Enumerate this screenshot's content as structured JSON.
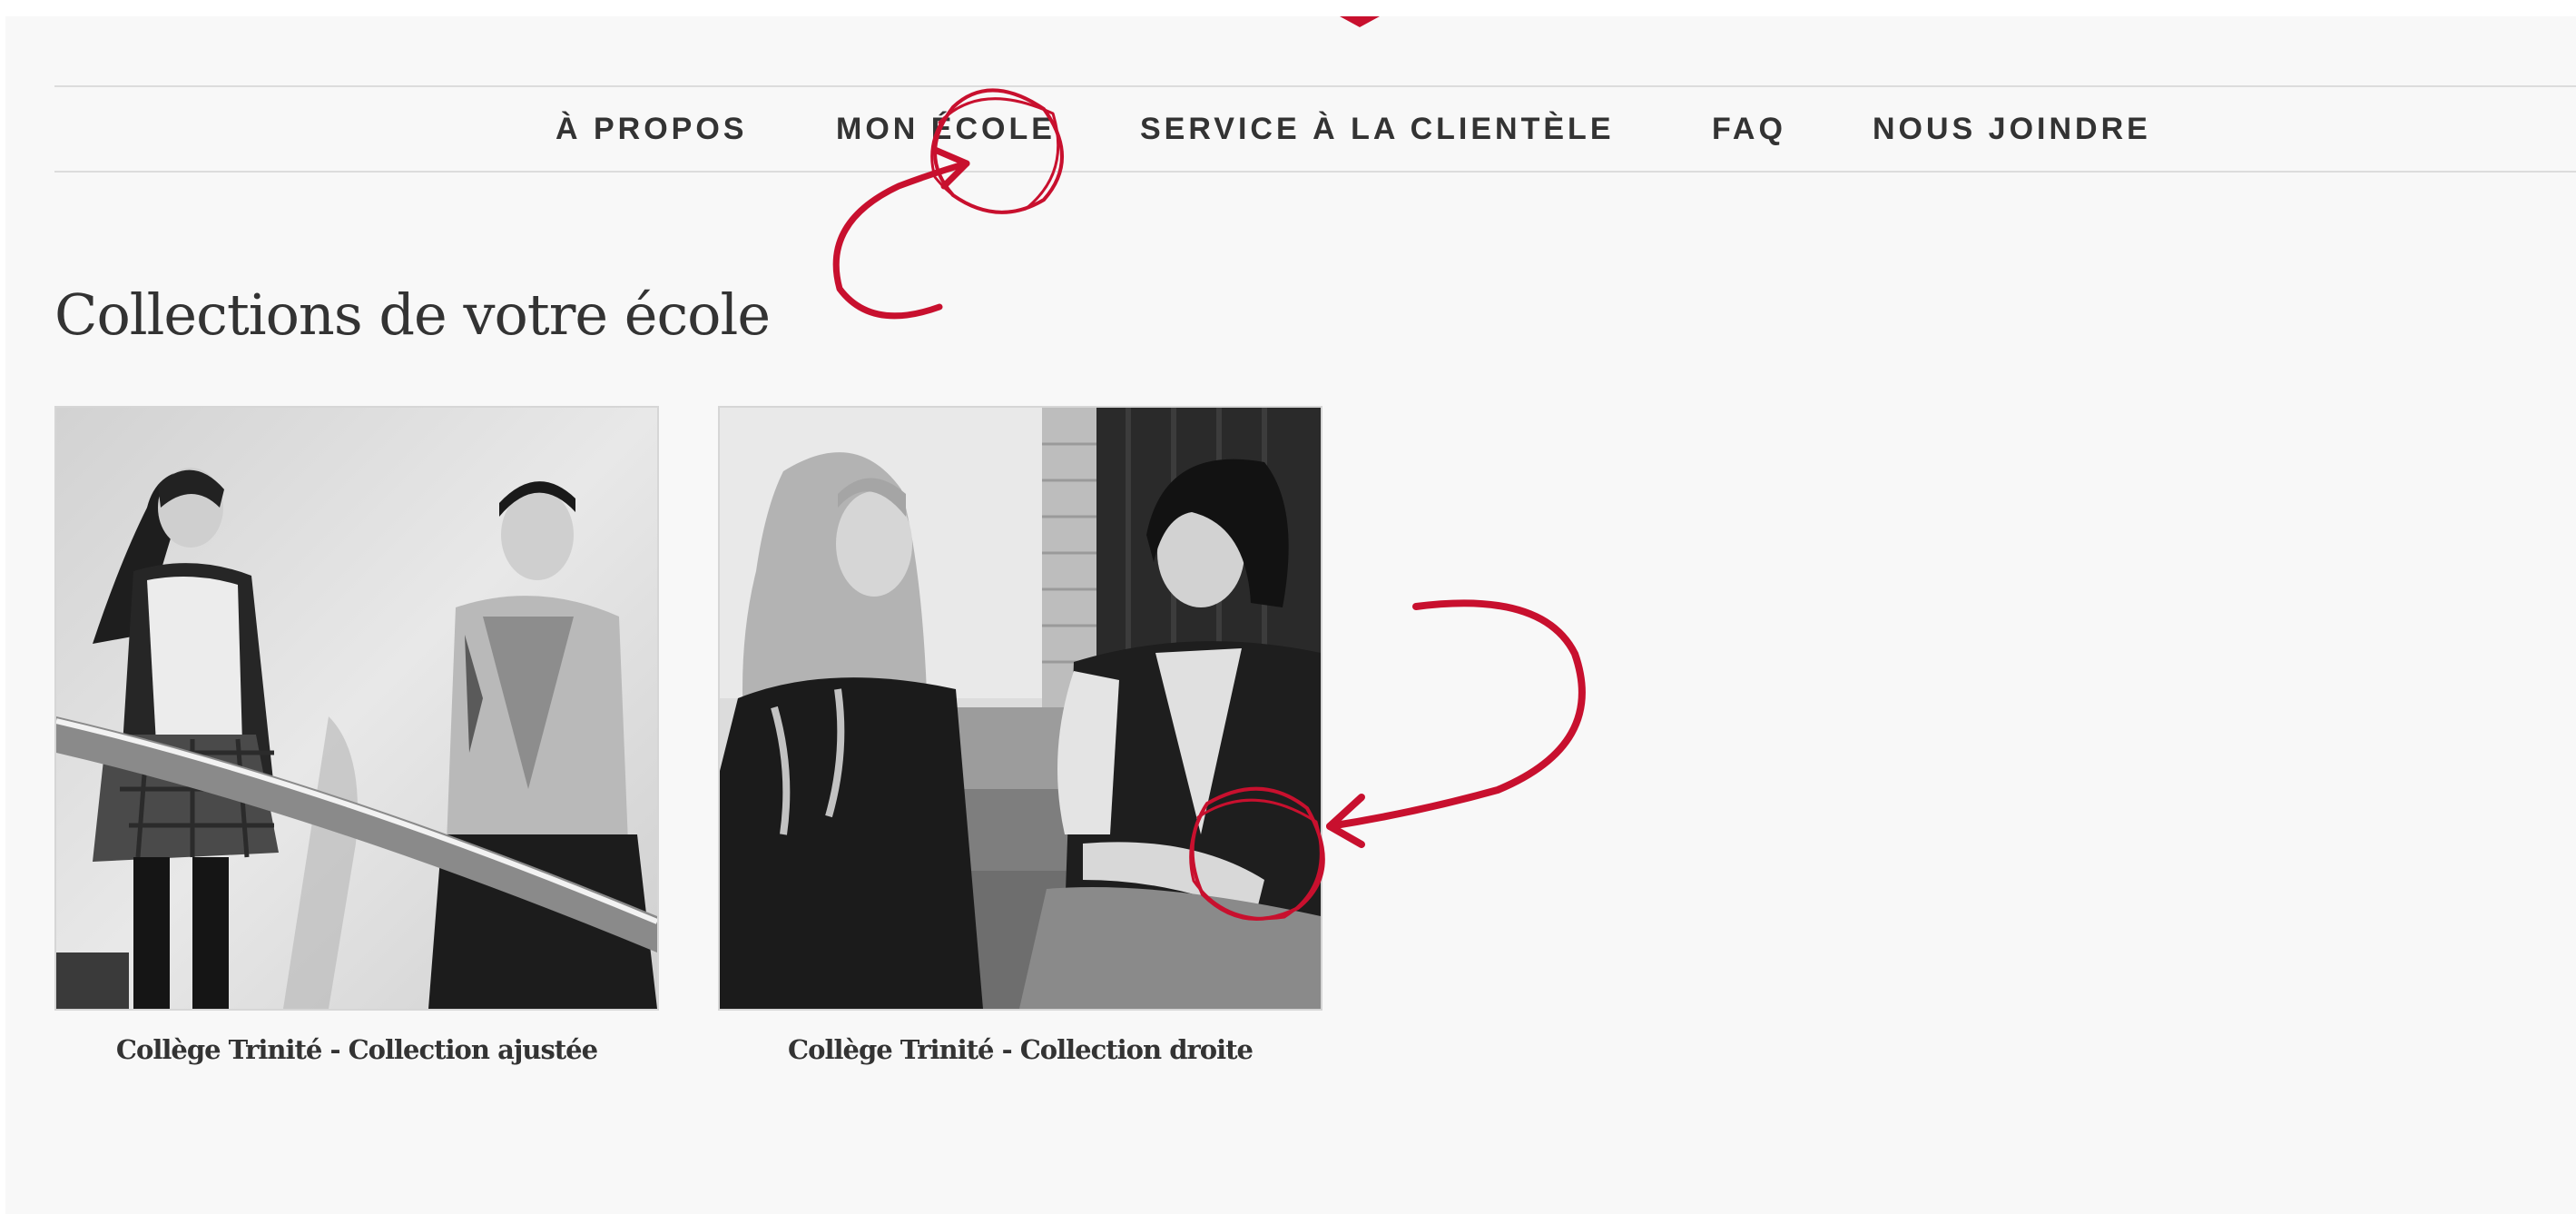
{
  "nav": {
    "items": [
      {
        "label": "À PROPOS"
      },
      {
        "label": "MON ÉCOLE"
      },
      {
        "label": "SERVICE À LA CLIENTÈLE"
      },
      {
        "label": "FAQ"
      },
      {
        "label": "NOUS JOINDRE"
      }
    ]
  },
  "main": {
    "heading": "Collections de votre école",
    "collections": [
      {
        "title": "Collège Trinité - Collection ajustée"
      },
      {
        "title": "Collège Trinité - Collection droite"
      }
    ]
  },
  "colors": {
    "accent": "#c8102e",
    "text": "#333333",
    "background": "#f8f8f8",
    "divider": "#dcdcdc"
  }
}
